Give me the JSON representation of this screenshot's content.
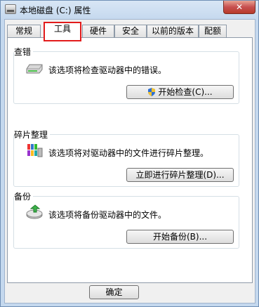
{
  "window": {
    "title": "本地磁盘 (C:) 属性",
    "close_label": "✕"
  },
  "tabs": [
    "常规",
    "工具",
    "硬件",
    "安全",
    "以前的版本",
    "配额"
  ],
  "active_tab": "工具",
  "groups": {
    "check": {
      "title": "查错",
      "desc": "该选项将检查驱动器中的错误。",
      "button": "开始检查(C)...",
      "icon": "drive-icon"
    },
    "defrag": {
      "title": "碎片整理",
      "desc": "该选项将对驱动器中的文件进行碎片整理。",
      "button": "立即进行碎片整理(D)...",
      "icon": "defrag-icon"
    },
    "backup": {
      "title": "备份",
      "desc": "该选项将备份驱动器中的文件。",
      "button": "开始备份(B)...",
      "icon": "backup-icon"
    }
  },
  "footer": {
    "ok_button": "确定"
  },
  "colors": {
    "highlight": "#e21b1b",
    "titlebar": "#c4d8ee",
    "close": "#c75050"
  }
}
